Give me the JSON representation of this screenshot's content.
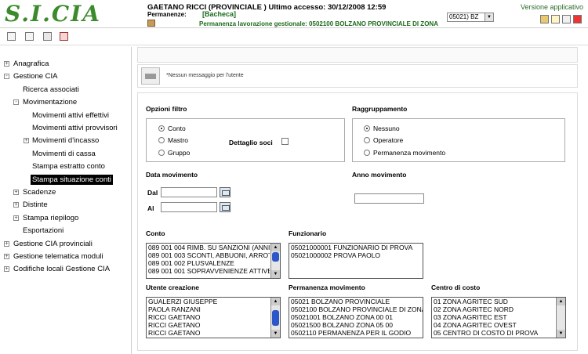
{
  "header": {
    "logo": "S.I.CIA",
    "user_line": "GAETANO RICCI (PROVINCIALE ) Ultimo accesso: 30/12/2008 12:59",
    "permanenze_label": "Permanenze:",
    "permanenze_value": "[Bacheca]",
    "permanenza_work": "Permanenza lavorazione gestionale: 0502100 BOLZANO PROVINCIALE DI ZONA",
    "select_value": "05021) BZ",
    "versione": "Versione applicativo"
  },
  "sidebar": {
    "items": [
      {
        "label": "Anagrafica",
        "toggle": "+"
      },
      {
        "label": "Gestione CIA",
        "toggle": "-"
      },
      {
        "label": "Ricerca associati",
        "toggle": ""
      },
      {
        "label": "Movimentazione",
        "toggle": "-"
      },
      {
        "label": "Movimenti attivi effettivi",
        "toggle": ""
      },
      {
        "label": "Movimenti attivi provvisori",
        "toggle": ""
      },
      {
        "label": "Movimenti d'incasso",
        "toggle": "+"
      },
      {
        "label": "Movimenti di cassa",
        "toggle": ""
      },
      {
        "label": "Stampa estratto conto",
        "toggle": ""
      },
      {
        "label": "Stampa situazione conti",
        "toggle": ""
      },
      {
        "label": "Scadenze",
        "toggle": "+"
      },
      {
        "label": "Distinte",
        "toggle": "+"
      },
      {
        "label": "Stampa riepilogo",
        "toggle": "+"
      },
      {
        "label": "Esportazioni",
        "toggle": ""
      },
      {
        "label": "Gestione CIA provinciali",
        "toggle": "+"
      },
      {
        "label": "Gestione telematica moduli",
        "toggle": "+"
      },
      {
        "label": "Codifiche locali Gestione CIA",
        "toggle": "+"
      }
    ]
  },
  "messages": {
    "text": "*Nessun messaggio per l'utente"
  },
  "form": {
    "opzioni_filtro": "Opzioni filtro",
    "opzioni": [
      "Conto",
      "Mastro",
      "Gruppo"
    ],
    "dettaglio_soci": "Dettaglio soci",
    "raggruppamento": "Raggruppamento",
    "raggruppamento_opzioni": [
      "Nessuno",
      "Operatore",
      "Permanenza movimento"
    ],
    "data_movimento": "Data movimento",
    "dal": "Dal",
    "al": "Al",
    "anno_movimento": "Anno movimento",
    "conto_label": "Conto",
    "conto": [
      "089 001 004 RIMB. SU SANZIONI (ANNI PR",
      "089 001 003 SCONTI, ABBUONI, ARROTON",
      "089 001 002 PLUSVALENZE",
      "089 001 001 SOPRAVVENIENZE ATTIVE"
    ],
    "funzionario_label": "Funzionario",
    "funzionario": [
      "05021000001 FUNZIONARIO DI PROVA",
      "05021000002 PROVA PAOLO"
    ],
    "utente_label": "Utente creazione",
    "utente": [
      "GUALERZI GIUSEPPE",
      "PAOLA RANZANI",
      "RICCI GAETANO",
      "RICCI GAETANO",
      "RICCI GAETANO"
    ],
    "permanenza_label": "Permanenza movimento",
    "permanenza": [
      "05021 BOLZANO PROVINCIALE",
      "0502100 BOLZANO PROVINCIALE DI ZONA",
      "05021001 BOLZANO ZONA 00 01",
      "05021500 BOLZANO ZONA 05 00",
      "0502110 PERMANENZA PER IL GODIO"
    ],
    "centro_label": "Centro di costo",
    "centro": [
      "01 ZONA AGRITEC SUD",
      "02 ZONA AGRITEC NORD",
      "03 ZONA AGRITEC EST",
      "04 ZONA AGRITEC OVEST",
      "05 CENTRO DI COSTO DI PROVA"
    ]
  }
}
